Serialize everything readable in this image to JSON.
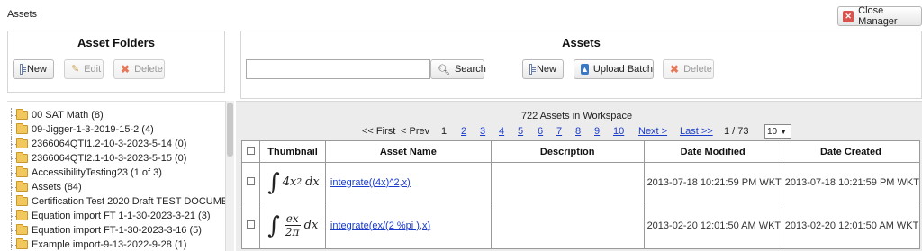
{
  "header": {
    "title": "Assets",
    "close_label": "Close Manager"
  },
  "folders_panel": {
    "title": "Asset Folders",
    "new_label": "New",
    "edit_label": "Edit",
    "delete_label": "Delete",
    "items": [
      "00 SAT Math (8)",
      "09-Jigger-1-3-2019-15-2 (4)",
      "2366064QTI1.2-10-3-2023-5-14 (0)",
      "2366064QTI2.1-10-3-2023-5-15 (0)",
      "AccessibilityTesting23 (1 of 3)",
      "Assets (84)",
      "Certification Test 2020 Draft TEST DOCUMEN",
      "Equation import FT 1-1-30-2023-3-21 (3)",
      "Equation import FT-1-30-2023-3-16 (5)",
      "Example import-9-13-2022-9-28 (1)"
    ]
  },
  "assets_panel": {
    "title": "Assets",
    "search_placeholder": "",
    "search_label": "Search",
    "new_label": "New",
    "upload_label": "Upload Batch",
    "delete_label": "Delete"
  },
  "workspace": {
    "count_text": "722 Assets in Workspace",
    "first": "<< First",
    "prev": "< Prev",
    "pages": [
      "1",
      "2",
      "3",
      "4",
      "5",
      "6",
      "7",
      "8",
      "9",
      "10"
    ],
    "next": "Next >",
    "last": "Last >>",
    "page_of": "1 / 73",
    "page_size": "10"
  },
  "table": {
    "headers": [
      "Thumbnail",
      "Asset Name",
      "Description",
      "Date Modified",
      "Date Created"
    ],
    "rows": [
      {
        "name": "integrate((4x)^2,x)",
        "description": "",
        "modified": "2013-07-18 10:21:59 PM WKT",
        "created": "2013-07-18 10:21:59 PM WKT"
      },
      {
        "name": "integrate(ex/(2 %pi ),x)",
        "description": "",
        "modified": "2013-02-20 12:01:50 AM WKT",
        "created": "2013-02-20 12:01:50 AM WKT"
      }
    ]
  },
  "colors": {
    "link": "#1a3ccc",
    "folder": "#f2c75c",
    "panel_bg": "#ececec"
  }
}
